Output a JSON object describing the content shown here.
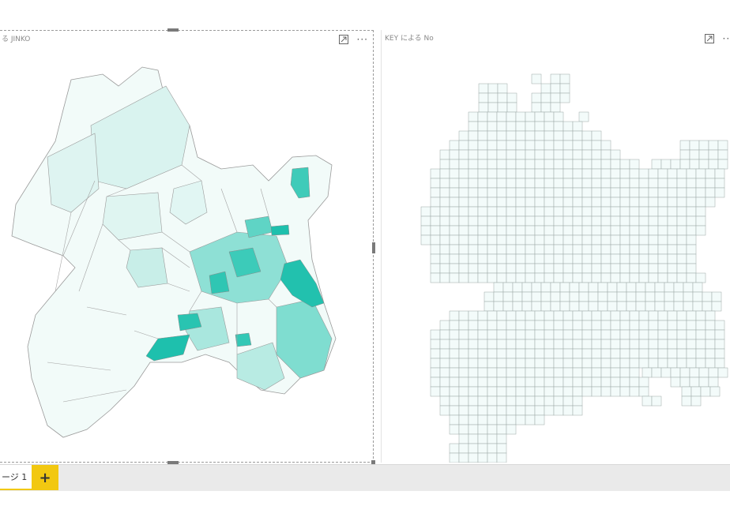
{
  "left_visual": {
    "title": "る JINKO",
    "focus_icon": "focus-mode-icon",
    "more_label": "···"
  },
  "right_visual": {
    "title": "KEY による No",
    "focus_icon": "focus-mode-icon",
    "more_label": "···"
  },
  "page_tabs": {
    "active_label": "ージ 1",
    "add_label": "+"
  },
  "colors": {
    "accent": "#1fbfad",
    "light": "#f0faf8",
    "tab_accent": "#f2c811",
    "tabbar": "#eaeaea"
  }
}
